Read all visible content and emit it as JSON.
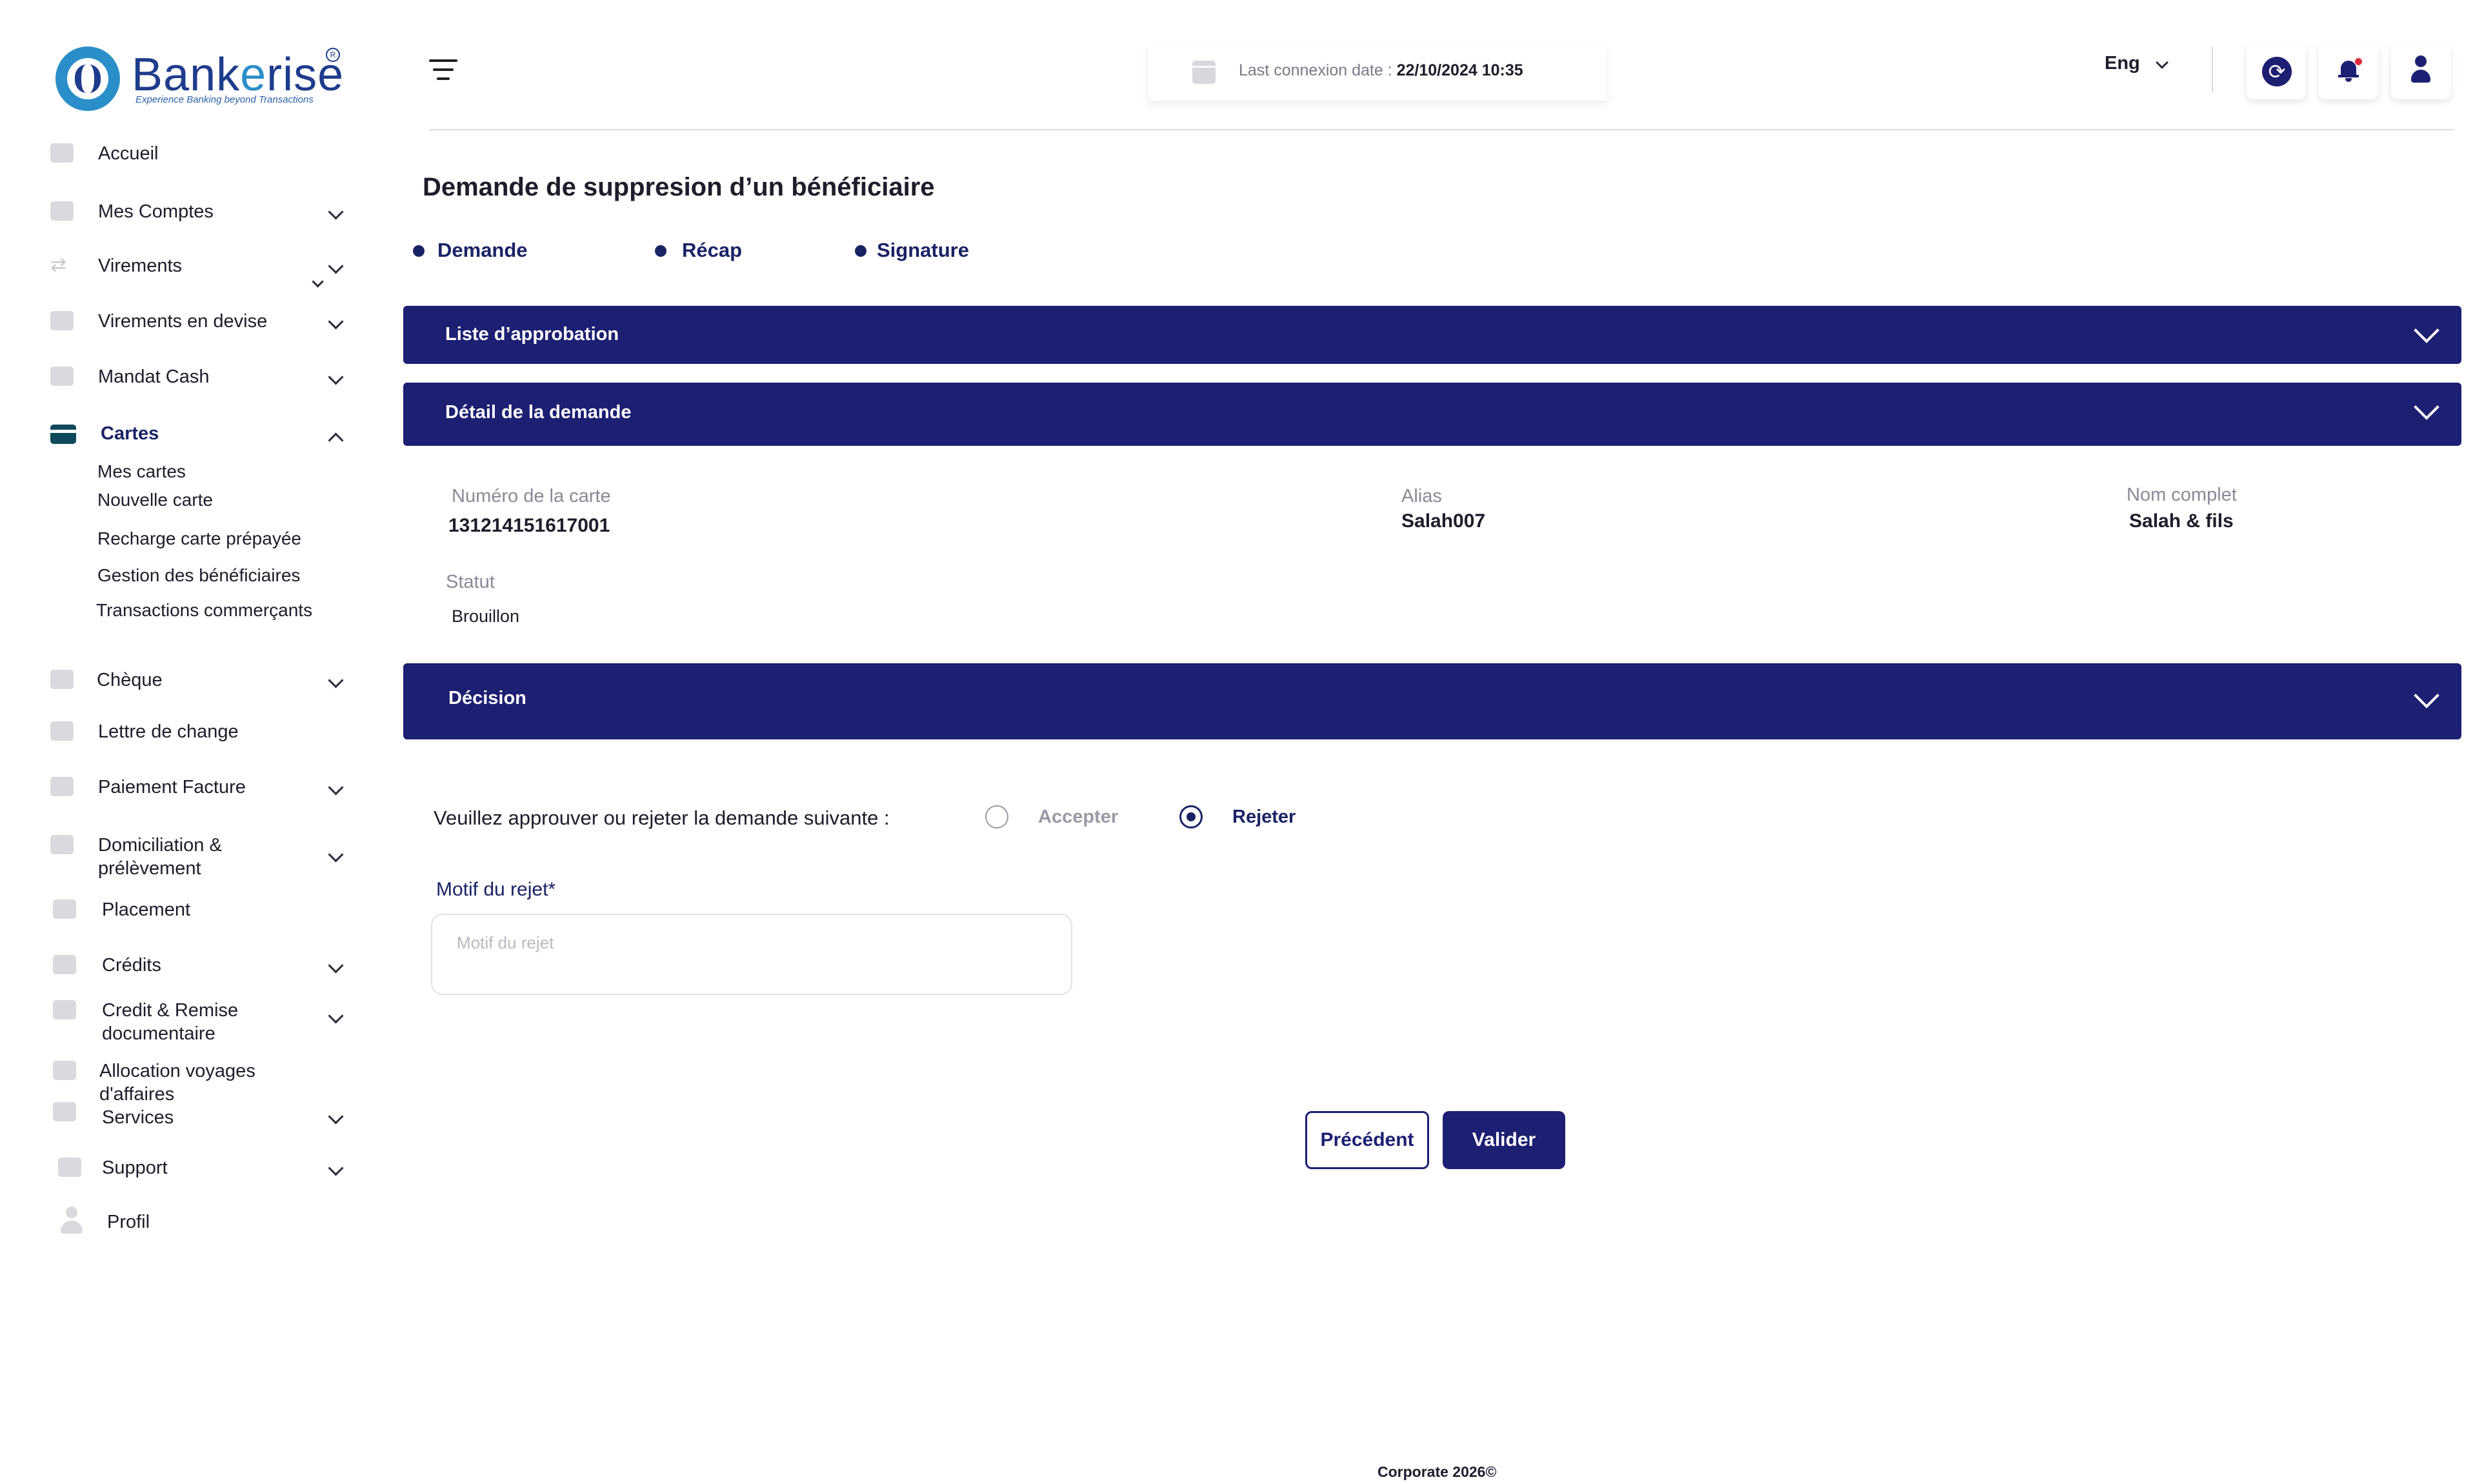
{
  "brand": {
    "name_part1": "Bank",
    "name_part2": "e",
    "name_part3": "rise",
    "registered": "R",
    "tagline": "Experience Banking beyond Transactions"
  },
  "sidebar": {
    "items": [
      {
        "label": "Accueil",
        "icon": "home-icon"
      },
      {
        "label": "Mes Comptes",
        "icon": "folder-icon"
      },
      {
        "label": "Virements",
        "icon": "transfer-icon"
      },
      {
        "label": "Virements en devise",
        "icon": "currency-icon"
      },
      {
        "label": "Mandat Cash",
        "icon": "mail-icon"
      },
      {
        "label": "Cartes",
        "icon": "card-icon"
      },
      {
        "label": "Chèque",
        "icon": "cheque-icon"
      },
      {
        "label": "Lettre de change",
        "icon": "mail-icon"
      },
      {
        "label": "Paiement Facture",
        "icon": "invoice-icon"
      },
      {
        "label": "Domiciliation &",
        "label2": "prélèvement",
        "icon": "mail-icon"
      },
      {
        "label": "Placement",
        "icon": "chart-icon"
      },
      {
        "label": "Crédits",
        "icon": "mail-icon"
      },
      {
        "label": "Credit & Remise",
        "label2": "documentaire",
        "icon": "mail-icon"
      },
      {
        "label": "Allocation  voyages",
        "label2": "d'affaires",
        "icon": "mail-icon"
      },
      {
        "label": "Services",
        "icon": "mail-icon"
      },
      {
        "label": "Support",
        "icon": "support-icon"
      },
      {
        "label": "Profil",
        "icon": "user-icon"
      }
    ],
    "cartes_sub": [
      "Mes cartes",
      "Nouvelle carte",
      "Recharge carte prépayée",
      "Gestion des bénéficiaires",
      "Transactions commerçants"
    ]
  },
  "header": {
    "connexion_label": "Last connexion date :",
    "connexion_value": "22/10/2024 10:35",
    "language": "Eng"
  },
  "main": {
    "title": "Demande de suppresion  d’un bénéficiaire",
    "steps": [
      "Demande",
      "Récap",
      "Signature"
    ],
    "sections": {
      "approbation": "Liste d’approbation",
      "detail": "Détail de la demande",
      "decision": "Décision"
    },
    "fields": {
      "card_number_label": "Numéro de la carte",
      "card_number_value": "131214151617001",
      "alias_label": "Alias",
      "alias_value": "Salah007",
      "fullname_label": "Nom complet",
      "fullname_value": "Salah & fils",
      "status_label": "Statut",
      "status_value": "Brouillon"
    },
    "decision": {
      "prompt": "Veuillez approuver ou rejeter la demande suivante :",
      "accept": "Accepter",
      "reject": "Rejeter",
      "selected": "Rejeter",
      "motif_label": "Motif du rejet*",
      "motif_placeholder": "Motif du rejet"
    },
    "buttons": {
      "previous": "Précédent",
      "submit": "Valider"
    }
  },
  "footer": "Corporate 2026©",
  "colors": {
    "primary": "#1c1f72",
    "brand_blue": "#1e3c8c",
    "brand_light": "#2a8fc8",
    "notification": "#e02b3c"
  }
}
